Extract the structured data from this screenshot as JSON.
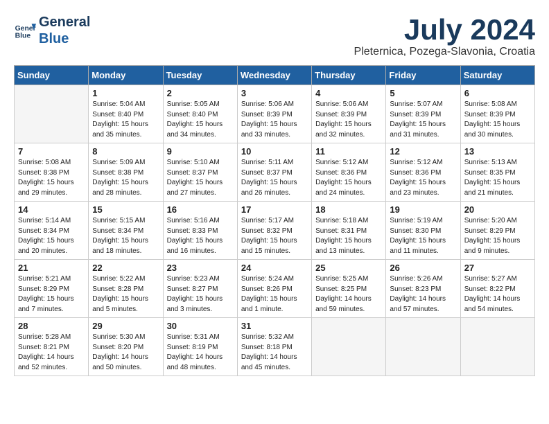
{
  "header": {
    "logo_line1": "General",
    "logo_line2": "Blue",
    "month": "July 2024",
    "location": "Pleternica, Pozega-Slavonia, Croatia"
  },
  "weekdays": [
    "Sunday",
    "Monday",
    "Tuesday",
    "Wednesday",
    "Thursday",
    "Friday",
    "Saturday"
  ],
  "weeks": [
    [
      {
        "day": "",
        "info": ""
      },
      {
        "day": "1",
        "info": "Sunrise: 5:04 AM\nSunset: 8:40 PM\nDaylight: 15 hours\nand 35 minutes."
      },
      {
        "day": "2",
        "info": "Sunrise: 5:05 AM\nSunset: 8:40 PM\nDaylight: 15 hours\nand 34 minutes."
      },
      {
        "day": "3",
        "info": "Sunrise: 5:06 AM\nSunset: 8:39 PM\nDaylight: 15 hours\nand 33 minutes."
      },
      {
        "day": "4",
        "info": "Sunrise: 5:06 AM\nSunset: 8:39 PM\nDaylight: 15 hours\nand 32 minutes."
      },
      {
        "day": "5",
        "info": "Sunrise: 5:07 AM\nSunset: 8:39 PM\nDaylight: 15 hours\nand 31 minutes."
      },
      {
        "day": "6",
        "info": "Sunrise: 5:08 AM\nSunset: 8:39 PM\nDaylight: 15 hours\nand 30 minutes."
      }
    ],
    [
      {
        "day": "7",
        "info": "Sunrise: 5:08 AM\nSunset: 8:38 PM\nDaylight: 15 hours\nand 29 minutes."
      },
      {
        "day": "8",
        "info": "Sunrise: 5:09 AM\nSunset: 8:38 PM\nDaylight: 15 hours\nand 28 minutes."
      },
      {
        "day": "9",
        "info": "Sunrise: 5:10 AM\nSunset: 8:37 PM\nDaylight: 15 hours\nand 27 minutes."
      },
      {
        "day": "10",
        "info": "Sunrise: 5:11 AM\nSunset: 8:37 PM\nDaylight: 15 hours\nand 26 minutes."
      },
      {
        "day": "11",
        "info": "Sunrise: 5:12 AM\nSunset: 8:36 PM\nDaylight: 15 hours\nand 24 minutes."
      },
      {
        "day": "12",
        "info": "Sunrise: 5:12 AM\nSunset: 8:36 PM\nDaylight: 15 hours\nand 23 minutes."
      },
      {
        "day": "13",
        "info": "Sunrise: 5:13 AM\nSunset: 8:35 PM\nDaylight: 15 hours\nand 21 minutes."
      }
    ],
    [
      {
        "day": "14",
        "info": "Sunrise: 5:14 AM\nSunset: 8:34 PM\nDaylight: 15 hours\nand 20 minutes."
      },
      {
        "day": "15",
        "info": "Sunrise: 5:15 AM\nSunset: 8:34 PM\nDaylight: 15 hours\nand 18 minutes."
      },
      {
        "day": "16",
        "info": "Sunrise: 5:16 AM\nSunset: 8:33 PM\nDaylight: 15 hours\nand 16 minutes."
      },
      {
        "day": "17",
        "info": "Sunrise: 5:17 AM\nSunset: 8:32 PM\nDaylight: 15 hours\nand 15 minutes."
      },
      {
        "day": "18",
        "info": "Sunrise: 5:18 AM\nSunset: 8:31 PM\nDaylight: 15 hours\nand 13 minutes."
      },
      {
        "day": "19",
        "info": "Sunrise: 5:19 AM\nSunset: 8:30 PM\nDaylight: 15 hours\nand 11 minutes."
      },
      {
        "day": "20",
        "info": "Sunrise: 5:20 AM\nSunset: 8:29 PM\nDaylight: 15 hours\nand 9 minutes."
      }
    ],
    [
      {
        "day": "21",
        "info": "Sunrise: 5:21 AM\nSunset: 8:29 PM\nDaylight: 15 hours\nand 7 minutes."
      },
      {
        "day": "22",
        "info": "Sunrise: 5:22 AM\nSunset: 8:28 PM\nDaylight: 15 hours\nand 5 minutes."
      },
      {
        "day": "23",
        "info": "Sunrise: 5:23 AM\nSunset: 8:27 PM\nDaylight: 15 hours\nand 3 minutes."
      },
      {
        "day": "24",
        "info": "Sunrise: 5:24 AM\nSunset: 8:26 PM\nDaylight: 15 hours\nand 1 minute."
      },
      {
        "day": "25",
        "info": "Sunrise: 5:25 AM\nSunset: 8:25 PM\nDaylight: 14 hours\nand 59 minutes."
      },
      {
        "day": "26",
        "info": "Sunrise: 5:26 AM\nSunset: 8:23 PM\nDaylight: 14 hours\nand 57 minutes."
      },
      {
        "day": "27",
        "info": "Sunrise: 5:27 AM\nSunset: 8:22 PM\nDaylight: 14 hours\nand 54 minutes."
      }
    ],
    [
      {
        "day": "28",
        "info": "Sunrise: 5:28 AM\nSunset: 8:21 PM\nDaylight: 14 hours\nand 52 minutes."
      },
      {
        "day": "29",
        "info": "Sunrise: 5:30 AM\nSunset: 8:20 PM\nDaylight: 14 hours\nand 50 minutes."
      },
      {
        "day": "30",
        "info": "Sunrise: 5:31 AM\nSunset: 8:19 PM\nDaylight: 14 hours\nand 48 minutes."
      },
      {
        "day": "31",
        "info": "Sunrise: 5:32 AM\nSunset: 8:18 PM\nDaylight: 14 hours\nand 45 minutes."
      },
      {
        "day": "",
        "info": ""
      },
      {
        "day": "",
        "info": ""
      },
      {
        "day": "",
        "info": ""
      }
    ]
  ]
}
